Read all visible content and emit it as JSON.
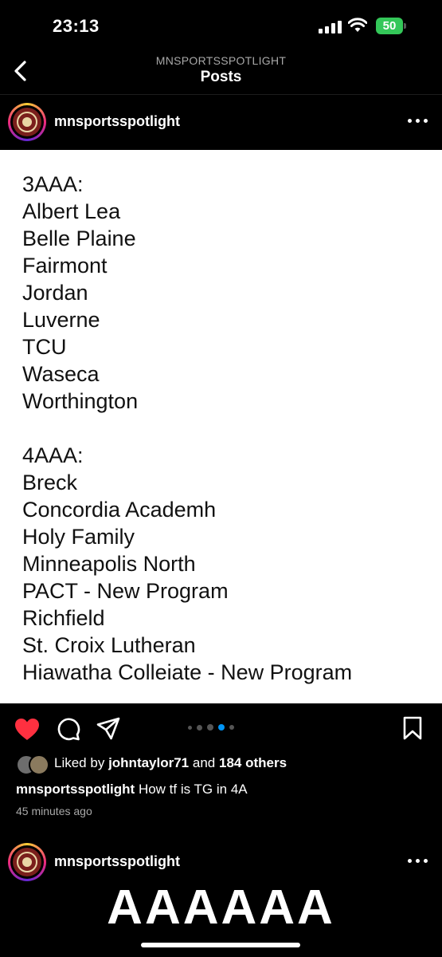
{
  "status_bar": {
    "time": "23:13",
    "battery": "50"
  },
  "nav": {
    "account": "MNSPORTSSPOTLIGHT",
    "title": "Posts"
  },
  "post": {
    "username": "mnsportsspotlight",
    "image_text_lines": [
      "3AAA:",
      "Albert Lea",
      "Belle Plaine",
      "Fairmont",
      "Jordan",
      "Luverne",
      "TCU",
      "Waseca",
      "Worthington",
      "",
      "4AAA:",
      "Breck",
      "Concordia Academh",
      "Holy Family",
      "Minneapolis North",
      "PACT - New Program",
      "Richfield",
      "St. Croix Lutheran",
      "Hiawatha Colleiate - New Program"
    ],
    "liked_by_prefix": "Liked by",
    "liked_by_user": "johntaylor71",
    "liked_by_middle": "and",
    "liked_by_others": "184 others",
    "caption_user": "mnsportsspotlight",
    "caption_text": "How tf is TG in 4A",
    "timestamp": "45 minutes ago",
    "liked": true,
    "carousel_count": 5,
    "carousel_active_index": 3
  },
  "next_post": {
    "username": "mnsportsspotlight",
    "preview_text": "AAAAAA"
  },
  "colors": {
    "like_red": "#ff3040",
    "active_dot": "#0095f6"
  }
}
